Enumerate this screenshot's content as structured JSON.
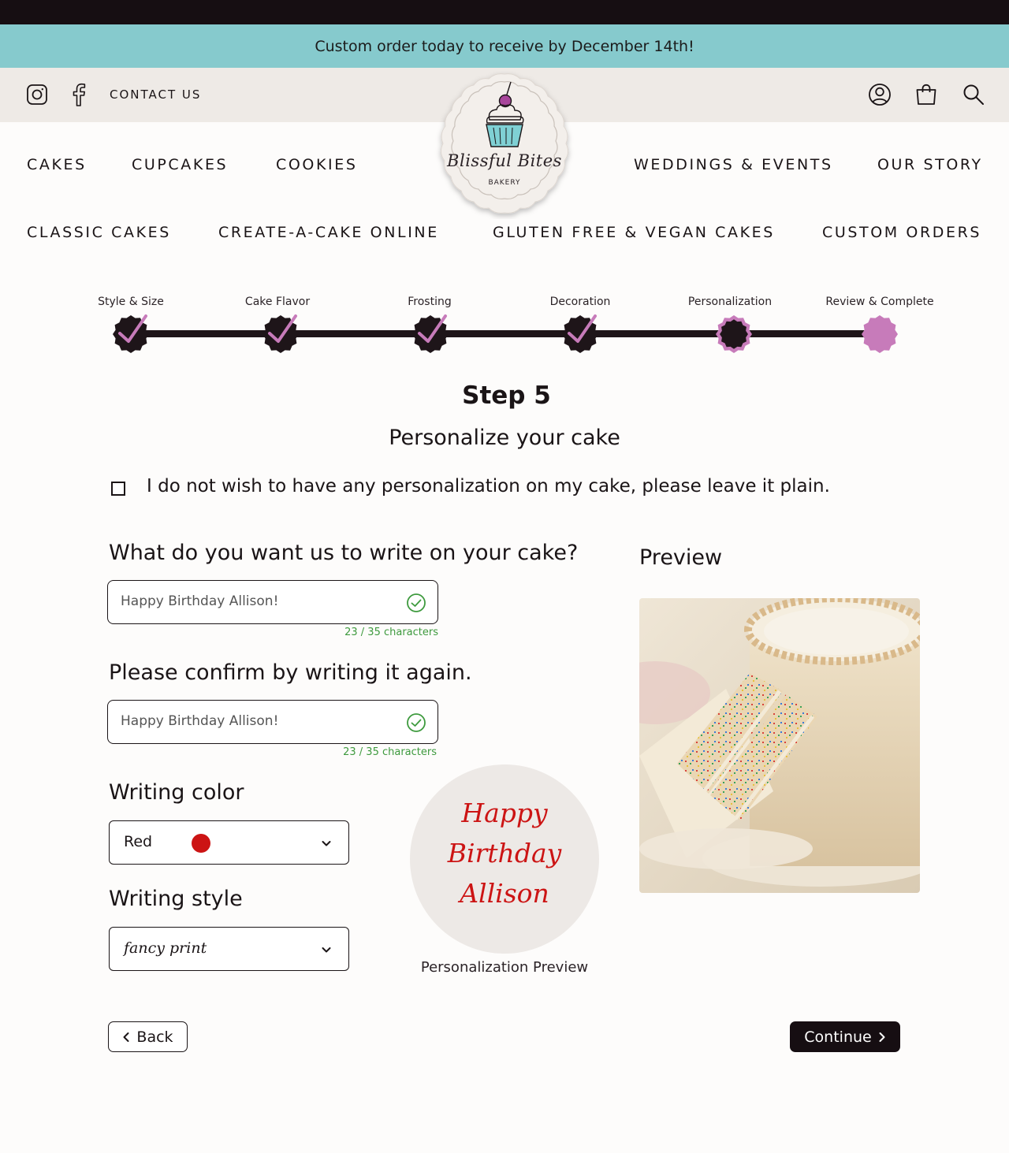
{
  "promo": {
    "text": "Custom order today to receive by December 14th!"
  },
  "utility": {
    "contact_label": "CONTACT US",
    "left_icons": [
      "instagram-icon",
      "facebook-icon"
    ],
    "right_icons": [
      "account-icon",
      "cart-icon",
      "search-icon"
    ]
  },
  "logo": {
    "script": "Blissful Bites",
    "sub": "BAKERY"
  },
  "nav": {
    "primary": [
      "CAKES",
      "CUPCAKES",
      "COOKIES",
      "WEDDINGS & EVENTS",
      "OUR STORY"
    ],
    "secondary": [
      "CLASSIC CAKES",
      "CREATE-A-CAKE ONLINE",
      "GLUTEN FREE & VEGAN CAKES",
      "CUSTOM ORDERS"
    ]
  },
  "steps": {
    "labels": [
      "Style & Size",
      "Cake Flavor",
      "Frosting",
      "Decoration",
      "Personalization",
      "Review & Complete"
    ],
    "states": [
      "complete",
      "complete",
      "complete",
      "complete",
      "current",
      "upcoming"
    ]
  },
  "colors": {
    "dark": "#160e12",
    "accent_pink": "#c77bba",
    "teal": "#86cacd",
    "check_green": "#3e9a3e",
    "writing_red": "#cc1414"
  },
  "heading": {
    "step": "Step 5",
    "subtitle": "Personalize your cake"
  },
  "plain_option": {
    "label": "I do not wish to have any personalization on my cake, please leave it plain.",
    "checked": false
  },
  "form": {
    "message_question": "What do you want us to write on your cake?",
    "message_value": "Happy Birthday Allison!",
    "message_count": "23 / 35 characters",
    "confirm_question": "Please confirm by writing it again.",
    "confirm_value": "Happy Birthday Allison!",
    "confirm_count": "23 / 35 characters",
    "color_label": "Writing color",
    "color_value": "Red",
    "style_label": "Writing style",
    "style_value": "fancy print"
  },
  "personalization_preview": {
    "lines": [
      "Happy",
      "Birthday",
      "Allison"
    ],
    "caption": "Personalization Preview"
  },
  "preview": {
    "title": "Preview"
  },
  "buttons": {
    "back": "Back",
    "continue": "Continue"
  }
}
